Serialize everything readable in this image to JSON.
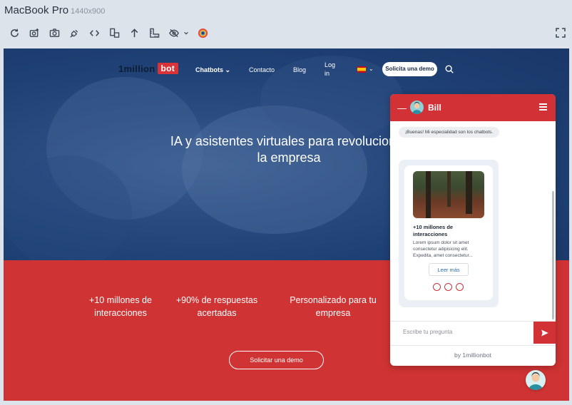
{
  "device": {
    "name": "MacBook Pro",
    "resolution": "1440x900"
  },
  "toolbar": {
    "icons": [
      "refresh-icon",
      "screenshot-settings-icon",
      "camera-icon",
      "plug-icon",
      "code-icon",
      "rotate-icon",
      "upload-icon",
      "ruler-icon",
      "eye-off-icon",
      "color-picker-icon",
      "fullscreen-icon"
    ]
  },
  "site": {
    "logo_text": "1million",
    "logo_badge": "bot",
    "nav": {
      "chatbots": "Chatbots",
      "contacto": "Contacto",
      "blog": "Blog",
      "login": "Log in",
      "demo_button": "Solicita una demo"
    },
    "hero_title": "IA y asistentes virtuales para revolucionar la empresa",
    "stats": [
      "+10 millones de interacciones",
      "+90% de respuestas acertadas",
      "Personalizado para tu empresa"
    ],
    "cta": "Solicitar una demo",
    "colors": {
      "hero_blue": "#1f4175",
      "brand_red": "#cf3333"
    }
  },
  "chat": {
    "minimize": "—",
    "bot_name": "Bill",
    "greeting": "¡Buenas! Mi especialidad son los chatbots.",
    "card": {
      "title": "+10 millones de interacciones",
      "text": "Lorem ipsum dolor sit amet consectetur adipisicing elit. Expedita, amet consectetur...",
      "button": "Leer más"
    },
    "input_placeholder": "Escribe tu pregunta",
    "footer": "by 1millionbot"
  }
}
